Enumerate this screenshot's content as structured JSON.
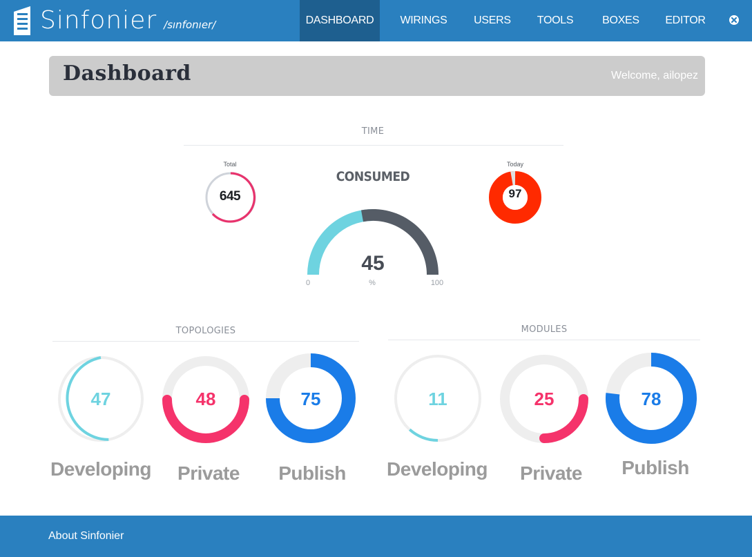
{
  "app": {
    "brand_name": "Sinfonier",
    "brand_subtitle": "/sınfonıer/"
  },
  "nav": {
    "items": [
      {
        "label": "DASHBOARD",
        "active": true
      },
      {
        "label": "WIRINGS",
        "active": false
      },
      {
        "label": "USERS",
        "active": false
      },
      {
        "label": "TOOLS",
        "active": false
      },
      {
        "label": "BOXES",
        "active": false
      },
      {
        "label": "EDITOR",
        "active": false
      }
    ],
    "logout_icon": "close-circle-icon"
  },
  "header": {
    "title": "Dashboard",
    "welcome": "Welcome, ailopez"
  },
  "time": {
    "section_label": "TIME",
    "total": {
      "label": "Total",
      "value": "645",
      "color": "#e8336d"
    },
    "today": {
      "label": "Today",
      "value": "97",
      "color": "#ff2a00"
    },
    "consumed": {
      "title": "CONSUMED",
      "value": "45",
      "unit": "%",
      "min": "0",
      "max": "100",
      "fill_color": "#6ed3e0",
      "rest_color": "#555c66"
    }
  },
  "topologies": {
    "section_label": "TOPOLOGIES",
    "items": [
      {
        "label": "Developing",
        "value": "47",
        "color": "#6ed3e0"
      },
      {
        "label": "Private",
        "value": "48",
        "color": "#f5336b"
      },
      {
        "label": "Publish",
        "value": "75",
        "color": "#1a7ce8"
      }
    ]
  },
  "modules": {
    "section_label": "MODULES",
    "items": [
      {
        "label": "Developing",
        "value": "11",
        "color": "#6ed3e0"
      },
      {
        "label": "Private",
        "value": "25",
        "color": "#f5336b"
      },
      {
        "label": "Publish",
        "value": "78",
        "color": "#1a7ce8"
      }
    ]
  },
  "footer": {
    "about": "About Sinfonier"
  }
}
